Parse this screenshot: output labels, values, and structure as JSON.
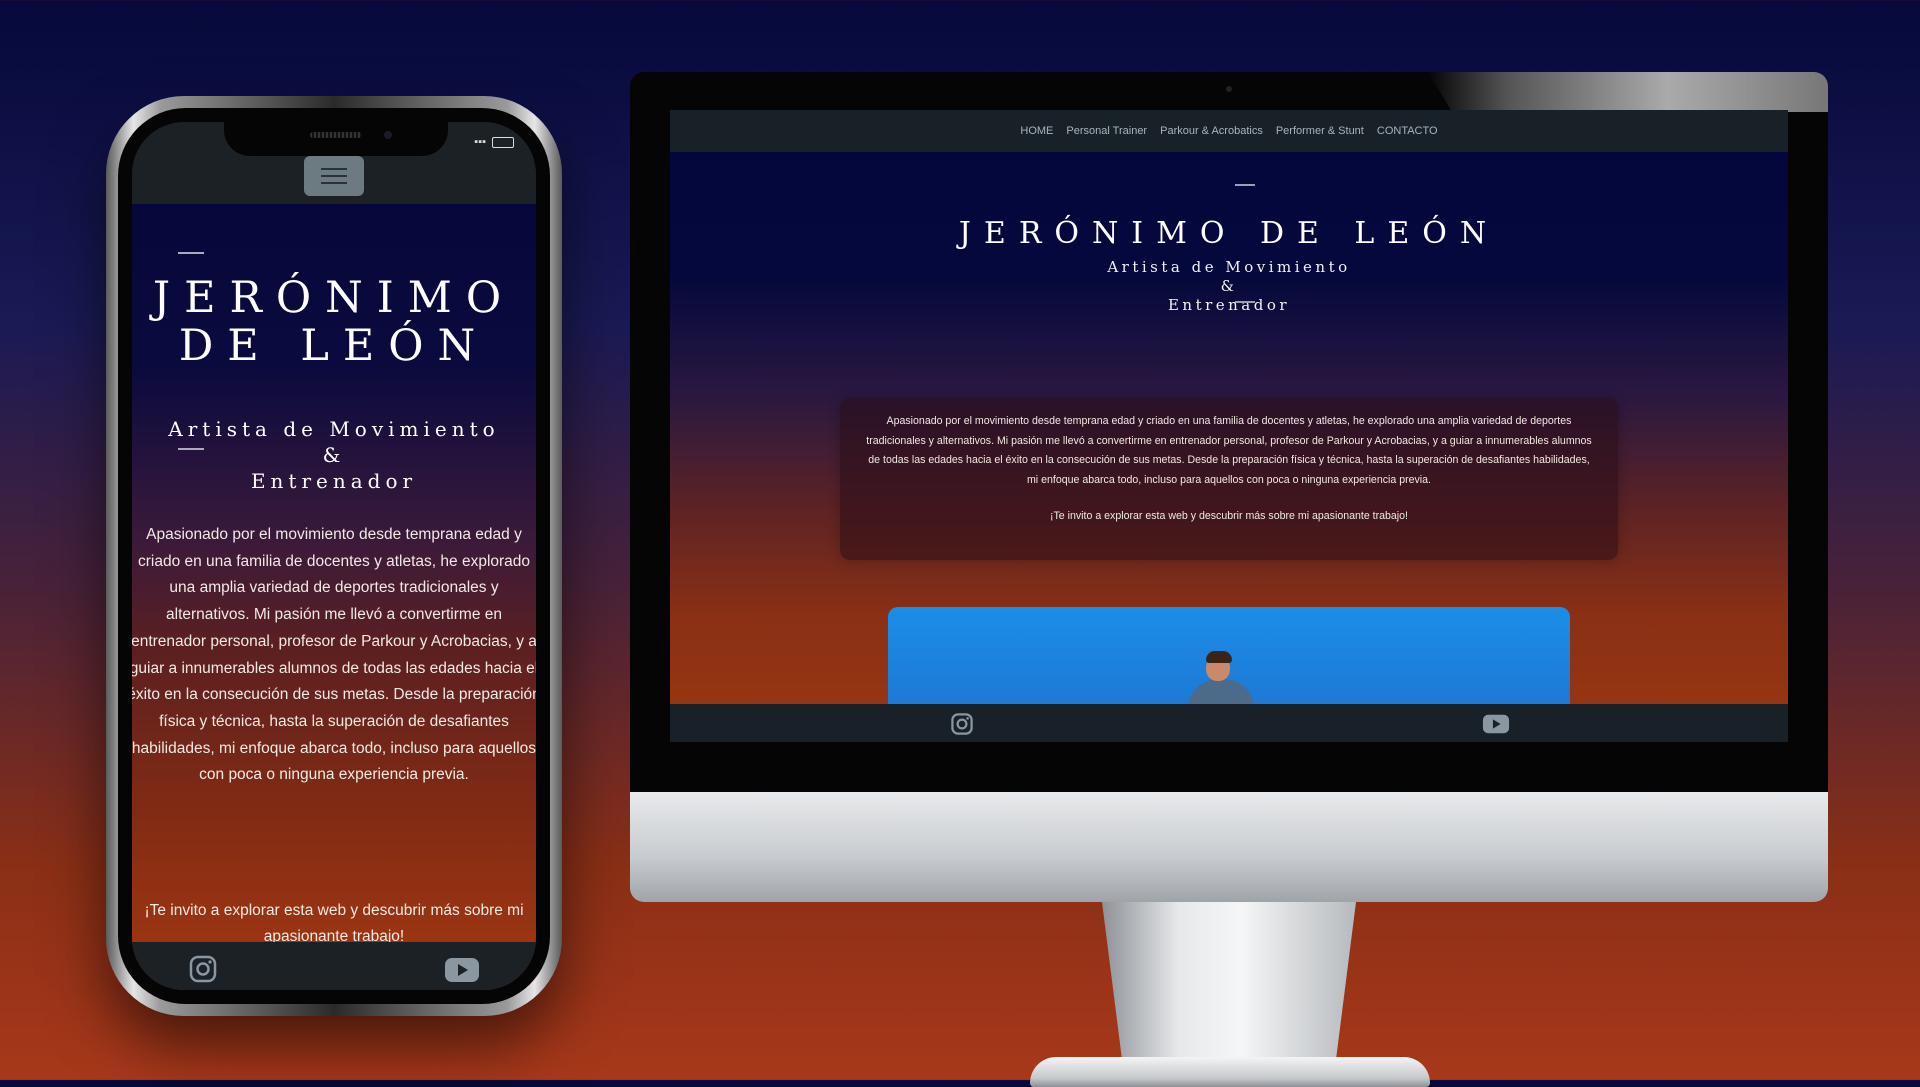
{
  "site": {
    "name_line1": "JERÓNIMO",
    "name_line2": "DE LEÓN",
    "name_full": "JERÓNIMO DE LEÓN",
    "subtitle_line1": "Artista de Movimiento",
    "subtitle_amp": "&",
    "subtitle_line2": "Entrenador",
    "bio": "Apasionado por el movimiento desde temprana edad y criado en una familia de docentes y atletas, he explorado una amplia variedad de deportes tradicionales y alternativos. Mi pasión me llevó a convertirme en entrenador personal, profesor de Parkour y Acrobacias, y a guiar a innumerables alumnos de todas las edades hacia el éxito en la consecución de sus metas. Desde la preparación física y técnica, hasta la superación de desafiantes habilidades, mi enfoque abarca todo, incluso para aquellos con poca o ninguna experiencia previa.",
    "invite": "¡Te invito a explorar esta web y descubrir más sobre mi apasionante trabajo!"
  },
  "nav": {
    "items": [
      "HOME",
      "Personal Trainer",
      "Parkour & Acrobatics",
      "Performer & Stunt",
      "CONTACTO"
    ]
  },
  "phone": {
    "bio_lines": [
      "Apasionado por el movimiento desde temprana edad y",
      "criado en una familia de docentes y atletas, he explorado",
      "una amplia variedad de deportes tradicionales y",
      "alternativos. Mi pasión me llevó a convertirme en",
      "entrenador personal, profesor de Parkour y Acrobacias, y a",
      "guiar a innumerables alumnos de todas las edades hacia el",
      "éxito en la consecución de sus metas. Desde la preparación",
      "física y técnica, hasta la superación de desafiantes",
      "habilidades, mi enfoque abarca todo, incluso para aquellos",
      "con poca o ninguna experiencia previa."
    ],
    "invite_line1": "¡Te invito a explorar esta web y descubrir más sobre mi",
    "invite_line2": "apasionante trabajo!"
  },
  "icons": {
    "menu": "hamburger-menu-icon",
    "instagram": "instagram-icon",
    "youtube": "youtube-icon"
  },
  "colors": {
    "header_bar": "#1c2126",
    "text": "#ffffff",
    "background_top": "#06093a",
    "background_bottom": "#a8381a"
  }
}
